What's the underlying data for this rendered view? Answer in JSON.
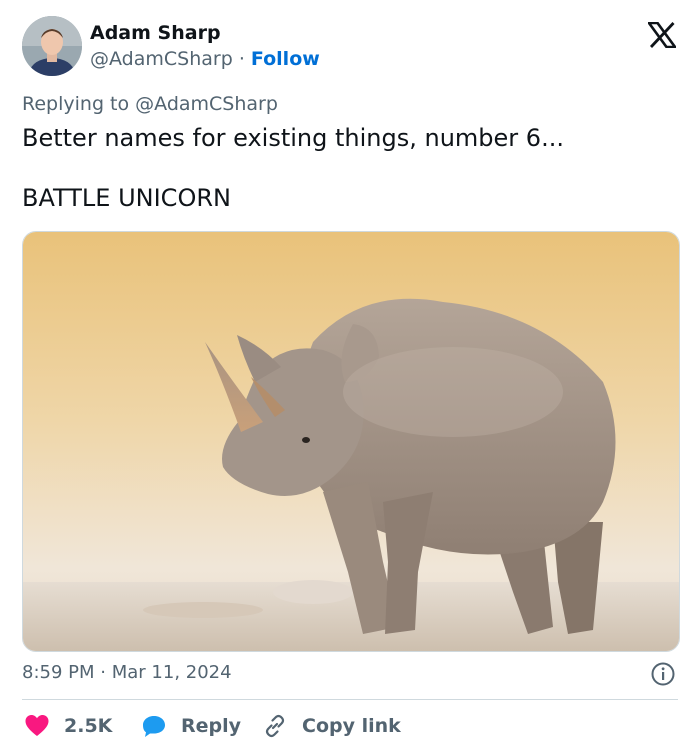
{
  "author": {
    "name": "Adam Sharp",
    "handle": "@AdamCSharp",
    "separator": "·",
    "follow_label": "Follow"
  },
  "reply_context": "Replying to @AdamCSharp",
  "tweet": {
    "line1": "Better names for existing things, number 6...",
    "line2": "BATTLE UNICORN"
  },
  "media": {
    "description_icon": "rhino-photo"
  },
  "meta": {
    "time": "8:59 PM",
    "separator": "·",
    "date": "Mar 11, 2024"
  },
  "actions": {
    "like_count": "2.5K",
    "reply_label": "Reply",
    "copy_label": "Copy link"
  },
  "colors": {
    "like": "#f91880",
    "reply": "#1d9bf0",
    "follow": "#006fd6",
    "secondary_text": "#536471"
  }
}
